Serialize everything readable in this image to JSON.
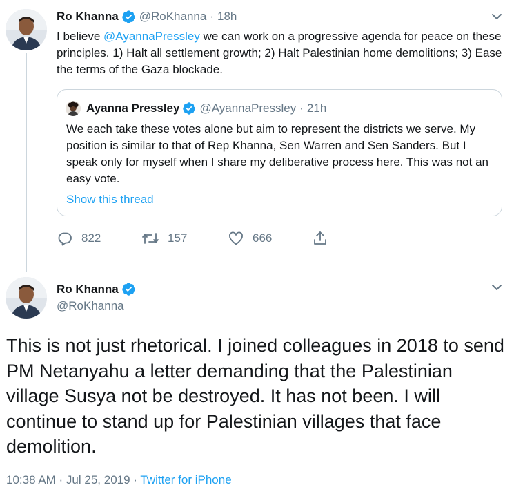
{
  "tweet1": {
    "author_name": "Ro Khanna",
    "author_handle": "@RoKhanna",
    "separator": "·",
    "time": "18h",
    "text_before": "I believe ",
    "mention": "@AyannaPressley",
    "text_after": " we can work on a progressive agenda for peace on these principles. 1) Halt all settlement growth; 2) Halt Palestinian home demolitions; 3) Ease the terms of the Gaza blockade.",
    "quote": {
      "author_name": "Ayanna Pressley",
      "author_handle": "@AyannaPressley",
      "separator": "·",
      "time": "21h",
      "text": "We each take these votes alone but aim to represent the districts we serve. My position is similar to that of Rep Khanna, Sen Warren and Sen Sanders. But I speak only for myself when I share my deliberative process here. This was not an easy vote.",
      "show_thread": "Show this thread"
    },
    "actions": {
      "replies": "822",
      "retweets": "157",
      "likes": "666"
    }
  },
  "tweet2": {
    "author_name": "Ro Khanna",
    "author_handle": "@RoKhanna",
    "text": "This is not just rhetorical. I joined colleagues in 2018 to send PM Netanyahu a letter demanding that the Palestinian village Susya not be destroyed. It has not been. I will continue to stand up for Palestinian villages that face demolition.",
    "timestamp": "10:38 AM · Jul 25, 2019",
    "meta_separator": " · ",
    "source": "Twitter for iPhone"
  },
  "icons": {
    "verified": "verified-badge-icon",
    "chevron": "chevron-down-icon",
    "reply": "reply-icon",
    "retweet": "retweet-icon",
    "like": "heart-icon",
    "share": "share-icon"
  },
  "colors": {
    "link": "#1da1f2",
    "secondary_text": "#657786",
    "border": "#ccd6dd",
    "primary_text": "#14171a"
  }
}
